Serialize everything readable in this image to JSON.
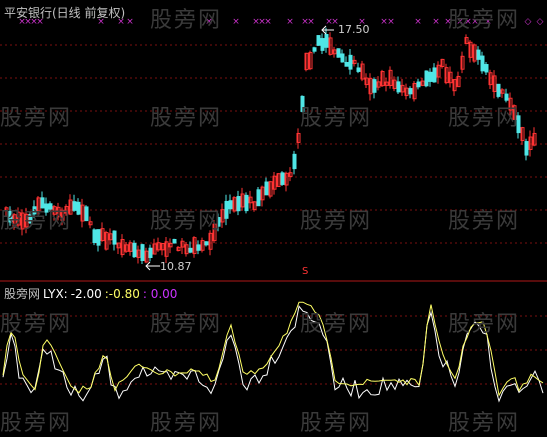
{
  "title": "平安银行(日线 前复权)",
  "watermark": "股旁网",
  "annotations": {
    "high": "17.50",
    "low": "10.87",
    "signal": "S"
  },
  "indicator": {
    "name": "股旁网",
    "label": "LYX:",
    "v1": "-2.00",
    "v2": ":-0.80",
    "v3": ": 0.00"
  },
  "colors": {
    "background": "#000000",
    "up": "#ff3333",
    "down": "#4fe6e6",
    "grid": "#7a1010",
    "marker": "#cc33cc",
    "line_white": "#ffffff",
    "line_yellow": "#ffff66",
    "zero": "#cc33ff",
    "signal": "#ff3333"
  }
}
